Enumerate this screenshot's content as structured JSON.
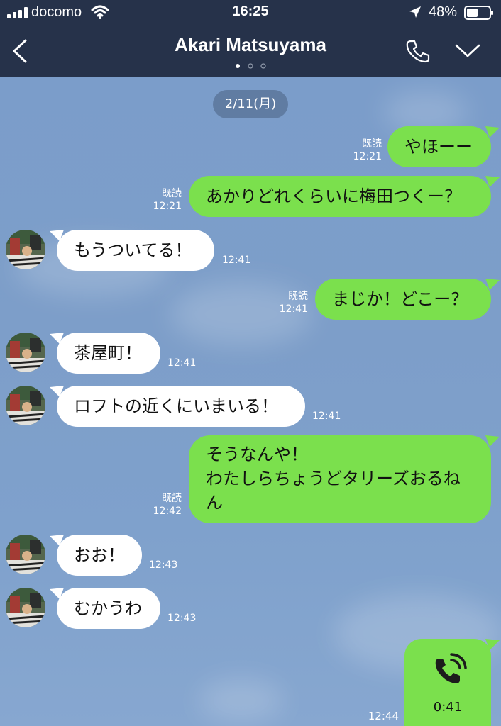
{
  "status": {
    "carrier": "docomo",
    "time": "16:25",
    "battery": "48%"
  },
  "header": {
    "title": "Akari Matsuyama"
  },
  "chat": {
    "date": "2/11(月)",
    "messages": [
      {
        "side": "out",
        "text": "やほーー",
        "read": "既読",
        "time": "12:21"
      },
      {
        "side": "out",
        "text": "あかりどれくらいに梅田つくー？",
        "read": "既読",
        "time": "12:21"
      },
      {
        "side": "in",
        "text": "もうついてる！",
        "time": "12:41"
      },
      {
        "side": "out",
        "text": "まじか！どこー？",
        "read": "既読",
        "time": "12:41"
      },
      {
        "side": "in",
        "text": "茶屋町！",
        "time": "12:41"
      },
      {
        "side": "in",
        "text": "ロフトの近くにいまいる！",
        "time": "12:41"
      },
      {
        "side": "out",
        "text": "そうなんや！\nわたしらちょうどタリーズおるね\nん",
        "read": "既読",
        "time": "12:42"
      },
      {
        "side": "in",
        "text": "おお！",
        "time": "12:43"
      },
      {
        "side": "in",
        "text": "むかうわ",
        "time": "12:43"
      }
    ],
    "call": {
      "duration": "0:41",
      "time": "12:44"
    }
  },
  "colors": {
    "header_bg": "#26324a",
    "chat_bg": "#7b9dca",
    "outgoing_bubble": "#7be04d",
    "incoming_bubble": "#ffffff"
  }
}
